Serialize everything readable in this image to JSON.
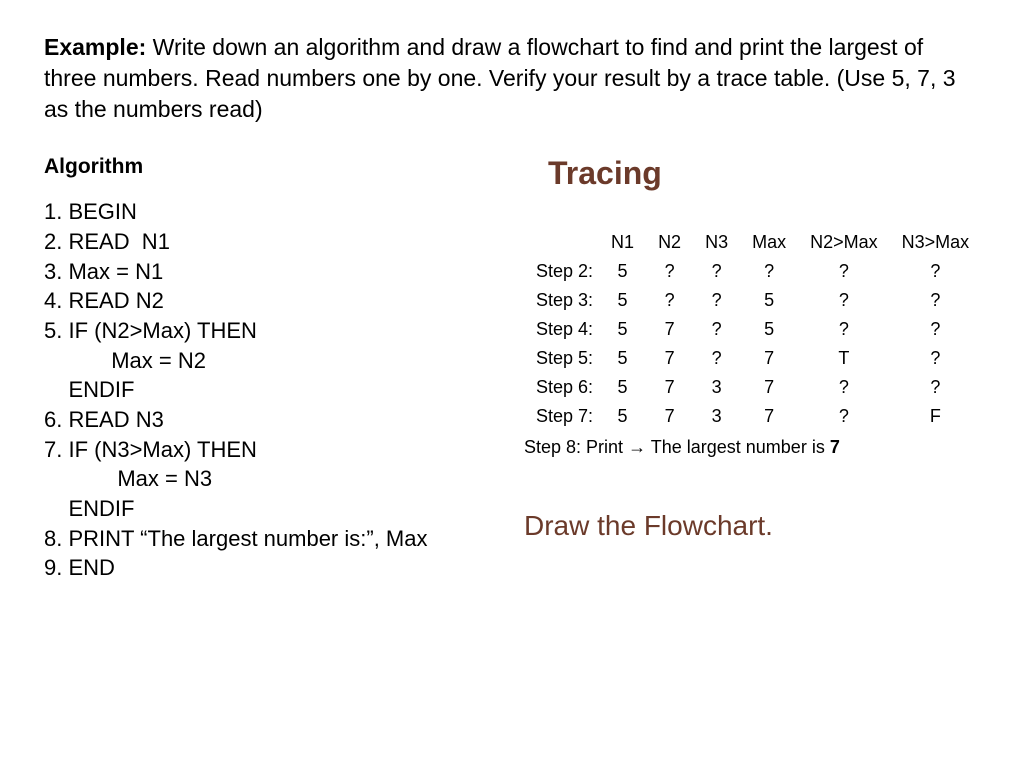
{
  "prompt": {
    "label": "Example:",
    "text": " Write down an algorithm and draw a flowchart to find and print the largest of three numbers. Read numbers one by one. Verify your result by a trace table. (Use 5, 7, 3 as the numbers read)"
  },
  "algorithm": {
    "heading": "Algorithm",
    "lines": [
      "1. BEGIN",
      "2. READ  N1",
      "3. Max = N1",
      "4. READ N2",
      "5. IF (N2>Max) THEN",
      "           Max = N2",
      "    ENDIF",
      "6. READ N3",
      "7. IF (N3>Max) THEN",
      "            Max = N3",
      "    ENDIF",
      "8. PRINT “The largest number is:”, Max",
      "9. END"
    ]
  },
  "tracing": {
    "heading": "Tracing",
    "headers": [
      "N1",
      "N2",
      "N3",
      "Max",
      "N2>Max",
      "N3>Max"
    ],
    "rows": [
      {
        "label": "Step 2:",
        "cells": [
          "5",
          "?",
          "?",
          "?",
          "?",
          "?"
        ]
      },
      {
        "label": "Step 3:",
        "cells": [
          "5",
          "?",
          "?",
          "5",
          "?",
          "?"
        ]
      },
      {
        "label": "Step 4:",
        "cells": [
          "5",
          "7",
          "?",
          "5",
          "?",
          "?"
        ]
      },
      {
        "label": "Step 5:",
        "cells": [
          "5",
          "7",
          "?",
          "7",
          "T",
          "?"
        ]
      },
      {
        "label": "Step 6:",
        "cells": [
          "5",
          "7",
          "3",
          "7",
          "?",
          "?"
        ]
      },
      {
        "label": "Step 7:",
        "cells": [
          "5",
          "7",
          "3",
          "7",
          "?",
          "F"
        ]
      }
    ],
    "step8": {
      "label": "Step 8:",
      "prefix": "  Print  ",
      "arrow": "→",
      "mid": " The largest number is ",
      "result": "7"
    }
  },
  "draw_flow": "Draw the Flowchart."
}
